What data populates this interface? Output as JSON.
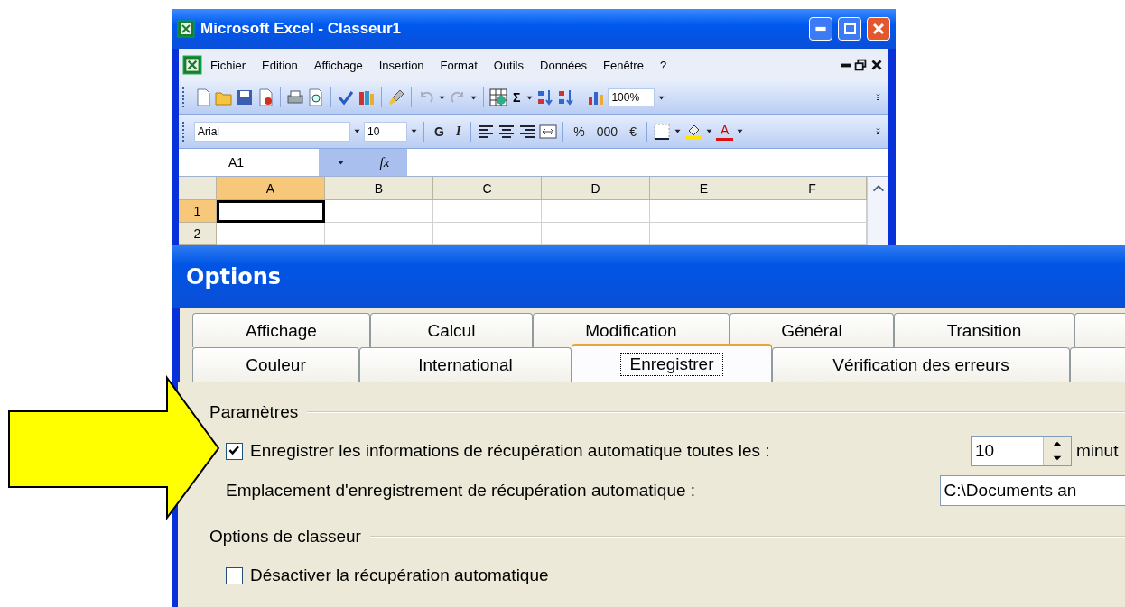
{
  "excel": {
    "title": "Microsoft Excel - Classeur1",
    "menu": [
      "Fichier",
      "Edition",
      "Affichage",
      "Insertion",
      "Format",
      "Outils",
      "Données",
      "Fenêtre",
      "?"
    ],
    "standard_toolbar": {
      "autosum": "Σ",
      "zoom": "100%"
    },
    "formatting_toolbar": {
      "font": "Arial",
      "size": "10",
      "bold": "G",
      "italic": "I",
      "percent": "%",
      "thousands": "000",
      "euro": "€",
      "font_color": "A"
    },
    "formula_bar": {
      "name_box": "A1",
      "function": "fx"
    },
    "grid": {
      "columns": [
        {
          "label": "A",
          "selected": true
        },
        {
          "label": "B",
          "selected": false
        },
        {
          "label": "C",
          "selected": false
        },
        {
          "label": "D",
          "selected": false
        },
        {
          "label": "E",
          "selected": false
        },
        {
          "label": "F",
          "selected": false
        }
      ],
      "rows": [
        {
          "label": "1",
          "selected": true
        },
        {
          "label": "2",
          "selected": false
        }
      ]
    }
  },
  "dialog": {
    "title": "Options",
    "tab_rows": [
      [
        {
          "label": "Affichage",
          "selected": false
        },
        {
          "label": "Calcul",
          "selected": false
        },
        {
          "label": "Modification",
          "selected": false
        },
        {
          "label": "Général",
          "selected": false
        },
        {
          "label": "Transition",
          "selected": false
        }
      ],
      [
        {
          "label": "Couleur",
          "selected": false
        },
        {
          "label": "International",
          "selected": false
        },
        {
          "label": "Enregistrer",
          "selected": true
        },
        {
          "label": "Vérification des erreurs",
          "selected": false
        }
      ]
    ],
    "groups": [
      {
        "title": "Paramètres",
        "items": [
          {
            "kind": "checkbox",
            "label": "Enregistrer les informations de récupération automatique toutes les :",
            "checked": true,
            "field": {
              "kind": "spin",
              "value": "10"
            },
            "unit": "minut"
          },
          {
            "kind": "text",
            "label": "Emplacement d'enregistrement de récupération automatique :",
            "field": {
              "kind": "text",
              "value": "C:\\Documents an"
            }
          }
        ]
      },
      {
        "title": "Options de classeur",
        "items": [
          {
            "kind": "checkbox",
            "label": "Désactiver la récupération automatique",
            "checked": false
          }
        ]
      }
    ]
  }
}
